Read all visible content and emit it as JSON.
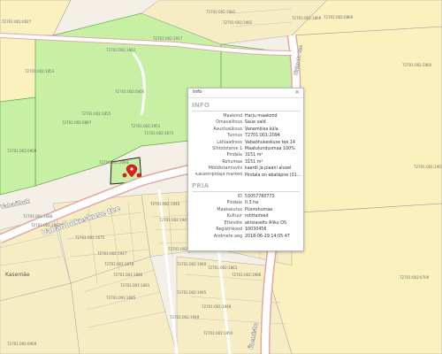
{
  "map": {
    "colors": {
      "background": "#f4f0e7",
      "parcel_yellow": "#fbf1bf",
      "parcel_green": "#c8f0a4",
      "parcel_border": "#9a9a9a",
      "road_pink": "#e3a8a4",
      "road_fill": "#ffffff",
      "marker_red": "#d9201c"
    },
    "street_labels": {
      "main": "Vabaõhukeskuse tee",
      "left": "Vabaõhuk",
      "bottom": "Ülemiste",
      "top_right": "Kalmeta tee"
    },
    "place_labels": {
      "kasemae": "Kasemäe"
    },
    "parcel_labels": [
      "72701:001:0027",
      "72701:002:0869",
      "72701:002:1981",
      "72701:002:1982",
      "72701:002:1861",
      "72701:002:1917",
      "72701:002:0400",
      "72701:002:1853",
      "72701:002:1855",
      "72701:002:0897",
      "72701:002:0900",
      "72701:002:1951",
      "72701:002:1873",
      "72701:001:2094",
      "72701:002:1940",
      "72701:002:1941",
      "72701:001:1688",
      "72701:001:1682",
      "72701:001:1675",
      "72701:002:1947",
      "72701:001:1678",
      "72701:001:1680",
      "72701:001:1681",
      "72701:001:1685",
      "72701:002:1940",
      "72701:002:1863",
      "72701:002:1945",
      "72701:002:1948",
      "72701:002:1949",
      "72701:002:1950",
      "72701:002:1986",
      "72701:002:0700",
      "72701:002:1860",
      "72701:002:1961",
      "72701:002:1869",
      "72701:001:1961",
      "72701:002:1862",
      "72701:002:0909"
    ]
  },
  "popup": {
    "title": "Info",
    "close_icon": "close-icon",
    "section_info": "INFO",
    "info_rows": [
      {
        "key": "Maakond",
        "value": "Harju maakond"
      },
      {
        "key": "Omavalitsus",
        "value": "Saue vald"
      },
      {
        "key": "Asustusüksus",
        "value": "Vanamõisa küla"
      },
      {
        "key": "Tunnus",
        "value": "72701:001:2094"
      },
      {
        "key": "Lähiaadress",
        "value": "Vabaõhukeskuse tee 14"
      },
      {
        "key": "Sihtotstarve 1",
        "value": "Maatulundusmaa 100%"
      },
      {
        "key": "Pindala",
        "value": "3151 m²"
      },
      {
        "key": "Rohumaa",
        "value": "3151 m²"
      },
      {
        "key": "Mõõdistamisviis",
        "value": "kaardi ja plaani alusel"
      },
      {
        "key": "Katastripidaja märked",
        "value": "Pindala on ebatäpne (01..."
      }
    ],
    "section_pria": "PRIA",
    "pria_rows": [
      {
        "key": "ID",
        "value": "53057780773"
      },
      {
        "key": "Pindala",
        "value": "0.3 ha"
      },
      {
        "key": "Maakasutus",
        "value": "Püsirohumaa"
      },
      {
        "key": "Kultuur",
        "value": "rohttaimed"
      },
      {
        "key": "Ettevõte",
        "value": "aktsiaselts Aliku OS"
      },
      {
        "key": "Registrikood",
        "value": "10030456"
      },
      {
        "key": "Andmete aeg",
        "value": "2018-06-29 14:05:47"
      }
    ]
  }
}
